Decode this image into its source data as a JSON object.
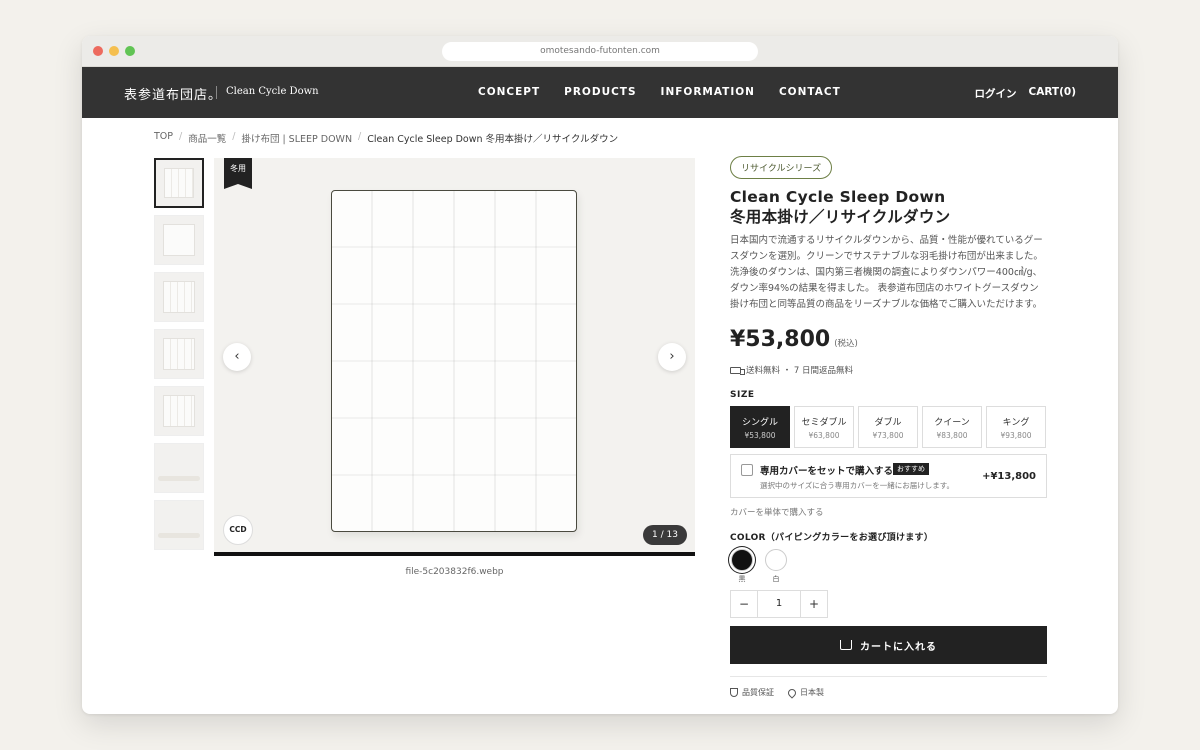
{
  "browser": {
    "url": "omotesando-futonten.com"
  },
  "header": {
    "logo_jp": "表参道布団店。",
    "logo_en": "Clean Cycle Down",
    "menu": [
      "CONCEPT",
      "PRODUCTS",
      "INFORMATION",
      "CONTACT"
    ],
    "login": "ログイン",
    "cart": "CART(0)"
  },
  "breadcrumb": [
    "TOP",
    "商品一覧",
    "掛け布団 | SLEEP DOWN",
    "Clean Cycle Sleep Down 冬用本掛け／リサイクルダウン"
  ],
  "gallery": {
    "badge": "冬用",
    "prev_icon": "‹",
    "next_icon": "›",
    "logo_mark": "CCD",
    "counter": "1 / 13",
    "file_caption": "file-5c203832f6.webp"
  },
  "product": {
    "series": "リサイクルシリーズ",
    "title_line1": "Clean Cycle Sleep Down",
    "title_line2": "冬用本掛け／リサイクルダウン",
    "description": "日本国内で流通するリサイクルダウンから、品質・性能が優れているグースダウンを選別。クリーンでサステナブルな羽毛掛け布団が出来ました。 洗浄後のダウンは、国内第三者機関の調査によりダウンパワー400㎤/g、ダウン率94%の結果を得ました。 表参道布団店のホワイトグースダウン掛け布団と同等品質の商品をリーズナブルな価格でご購入いただけます。",
    "price": "¥53,800",
    "tax": "(税込)",
    "shipping": "送料無料 ・ 7 日間返品無料",
    "size_label": "SIZE",
    "sizes": [
      {
        "name": "シングル",
        "price": "¥53,800"
      },
      {
        "name": "セミダブル",
        "price": "¥63,800"
      },
      {
        "name": "ダブル",
        "price": "¥73,800"
      },
      {
        "name": "クイーン",
        "price": "¥83,800"
      },
      {
        "name": "キング",
        "price": "¥93,800"
      }
    ],
    "cover": {
      "title": "専用カバーをセットで購入する",
      "tag": "おすすめ",
      "sub": "選択中のサイズに合う専用カバーを一緒にお届けします。",
      "price": "+¥13,800"
    },
    "cover_link": "カバーを単体で購入する",
    "color_label": "COLOR（パイピングカラーをお選び頂けます）",
    "colors": [
      {
        "name": "黒",
        "hex": "#111111"
      },
      {
        "name": "白",
        "hex": "#ffffff"
      }
    ],
    "quantity": "1",
    "qty_minus": "−",
    "qty_plus": "+",
    "add_to_cart": "カートに入れる",
    "badges": [
      "品質保証",
      "日本製"
    ]
  }
}
